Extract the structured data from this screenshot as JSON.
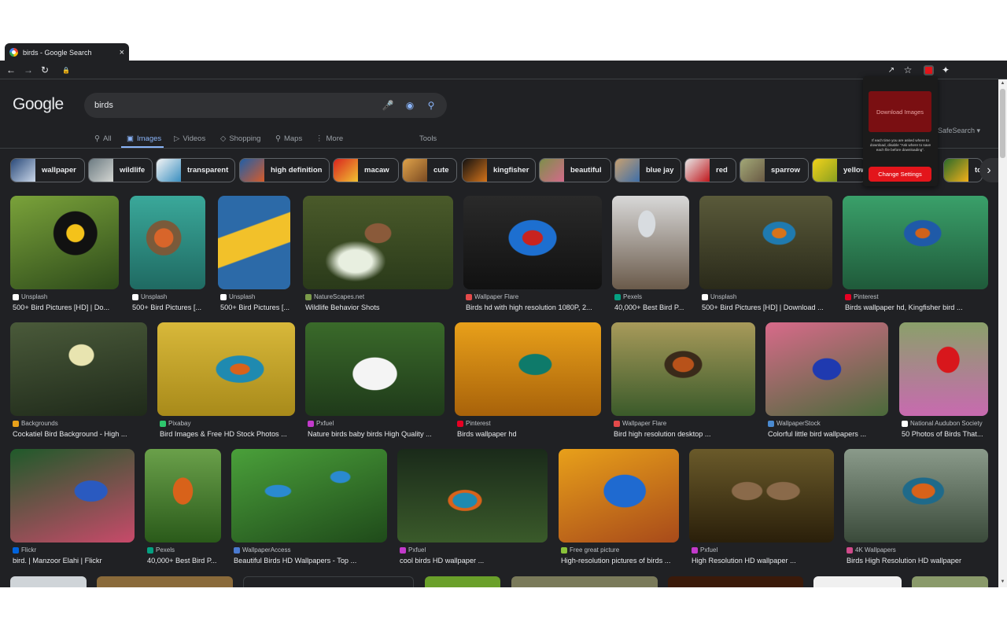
{
  "browser": {
    "tab_title": "birds - Google Search",
    "tab_close": "×"
  },
  "google": {
    "logo": "Google",
    "query": "birds",
    "nav": [
      {
        "label": "All",
        "icon": "search-icon"
      },
      {
        "label": "Images",
        "icon": "image-icon"
      },
      {
        "label": "Videos",
        "icon": "video-icon"
      },
      {
        "label": "Shopping",
        "icon": "tag-icon"
      },
      {
        "label": "Maps",
        "icon": "map-pin-icon"
      },
      {
        "label": "More",
        "icon": "more-vert-icon"
      }
    ],
    "tools": "Tools",
    "safesearch": "SafeSearch"
  },
  "chips": [
    "wallpaper",
    "wildlife",
    "transparent",
    "high definition",
    "macaw",
    "cute",
    "kingfisher",
    "beautiful",
    "blue jay",
    "red",
    "sparrow",
    "yellow",
    "to"
  ],
  "results": [
    {
      "source": "Unsplash",
      "title": "500+ Bird Pictures [HD] | Do..."
    },
    {
      "source": "Unsplash",
      "title": "500+ Bird Pictures [..."
    },
    {
      "source": "Unsplash",
      "title": "500+ Bird Pictures [..."
    },
    {
      "source": "NatureScapes.net",
      "title": "Wildlife Behavior Shots"
    },
    {
      "source": "Wallpaper Flare",
      "title": "Birds hd with high resolution 1080P, 2..."
    },
    {
      "source": "Pexels",
      "title": "40,000+ Best Bird P..."
    },
    {
      "source": "Unsplash",
      "title": "500+ Bird Pictures [HD] | Download ..."
    },
    {
      "source": "Pinterest",
      "title": "Birds wallpaper hd, Kingfisher bird ..."
    },
    {
      "source": "Backgrounds",
      "title": "Cockatiel Bird Background - High ..."
    },
    {
      "source": "Pixabay",
      "title": "Bird Images & Free HD Stock Photos ..."
    },
    {
      "source": "Pxfuel",
      "title": "Nature birds baby birds High Quality ..."
    },
    {
      "source": "Pinterest",
      "title": "Birds wallpaper hd"
    },
    {
      "source": "Wallpaper Flare",
      "title": "Bird high resolution desktop ..."
    },
    {
      "source": "WallpaperStock",
      "title": "Colorful little bird wallpapers ..."
    },
    {
      "source": "National Audubon Society",
      "title": "50 Photos of Birds That..."
    },
    {
      "source": "Flickr",
      "title": "bird. | Manzoor Elahi | Flickr"
    },
    {
      "source": "Pexels",
      "title": "40,000+ Best Bird P..."
    },
    {
      "source": "WallpaperAccess",
      "title": "Beautiful Birds HD Wallpapers - Top ..."
    },
    {
      "source": "Pxfuel",
      "title": "cool birds HD wallpaper ..."
    },
    {
      "source": "Free great picture",
      "title": "High-resolution pictures of birds ..."
    },
    {
      "source": "Pxfuel",
      "title": "High Resolution HD wallpaper ..."
    },
    {
      "source": "4K Wallpapers",
      "title": "Birds High Resolution HD wallpaper"
    }
  ],
  "popup": {
    "download_label": "Download Images",
    "note": "If each time you are asked where to download, disable \"Ask where to save each file before downloading\".",
    "settings_label": "Change Settings"
  },
  "colors": {
    "background": "#202124",
    "link_blue": "#8ab4f8",
    "popup_red": "#e3151b"
  }
}
